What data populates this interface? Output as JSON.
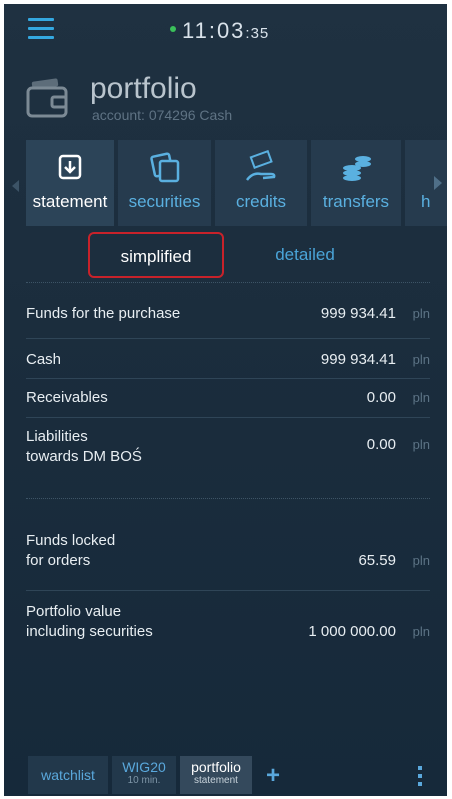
{
  "status_bar": {
    "time_main": "11:03",
    "time_seconds": ":35"
  },
  "header": {
    "title": "portfolio",
    "subtitle": "account: 074296 Cash"
  },
  "tabs": [
    {
      "label": "statement",
      "icon": "download-box-icon",
      "active": true
    },
    {
      "label": "securities",
      "icon": "documents-icon",
      "active": false
    },
    {
      "label": "credits",
      "icon": "hand-money-icon",
      "active": false
    },
    {
      "label": "transfers",
      "icon": "coins-stack-icon",
      "active": false
    },
    {
      "label": "h",
      "icon": "",
      "active": false
    }
  ],
  "view_toggle": {
    "simplified": "simplified",
    "detailed": "detailed",
    "selected": "simplified"
  },
  "rows": [
    {
      "label_lines": [
        "Funds for the purchase"
      ],
      "value": "999 934.41",
      "unit": "pln"
    },
    {
      "label_lines": [
        "Cash"
      ],
      "value": "999 934.41",
      "unit": "pln"
    },
    {
      "label_lines": [
        "Receivables"
      ],
      "value": "0.00",
      "unit": "pln"
    },
    {
      "label_lines": [
        "Liabilities",
        "towards DM BOŚ"
      ],
      "value": "0.00",
      "unit": "pln"
    },
    {
      "label_lines": [
        "Funds locked",
        "for orders"
      ],
      "value": "65.59",
      "unit": "pln"
    },
    {
      "label_lines": [
        "Portfolio value",
        "including securities"
      ],
      "value": "1 000 000.00",
      "unit": "pln"
    }
  ],
  "bottom_tabs": [
    {
      "line1": "watchlist",
      "line2": ""
    },
    {
      "line1": "WIG20",
      "line2": "10 min."
    },
    {
      "line1": "portfolio",
      "line2": "statement"
    }
  ],
  "colors": {
    "accent": "#34a8e0",
    "background": "#1b2d3d",
    "highlight_border": "#c8222a",
    "online_dot": "#3ac05a"
  }
}
